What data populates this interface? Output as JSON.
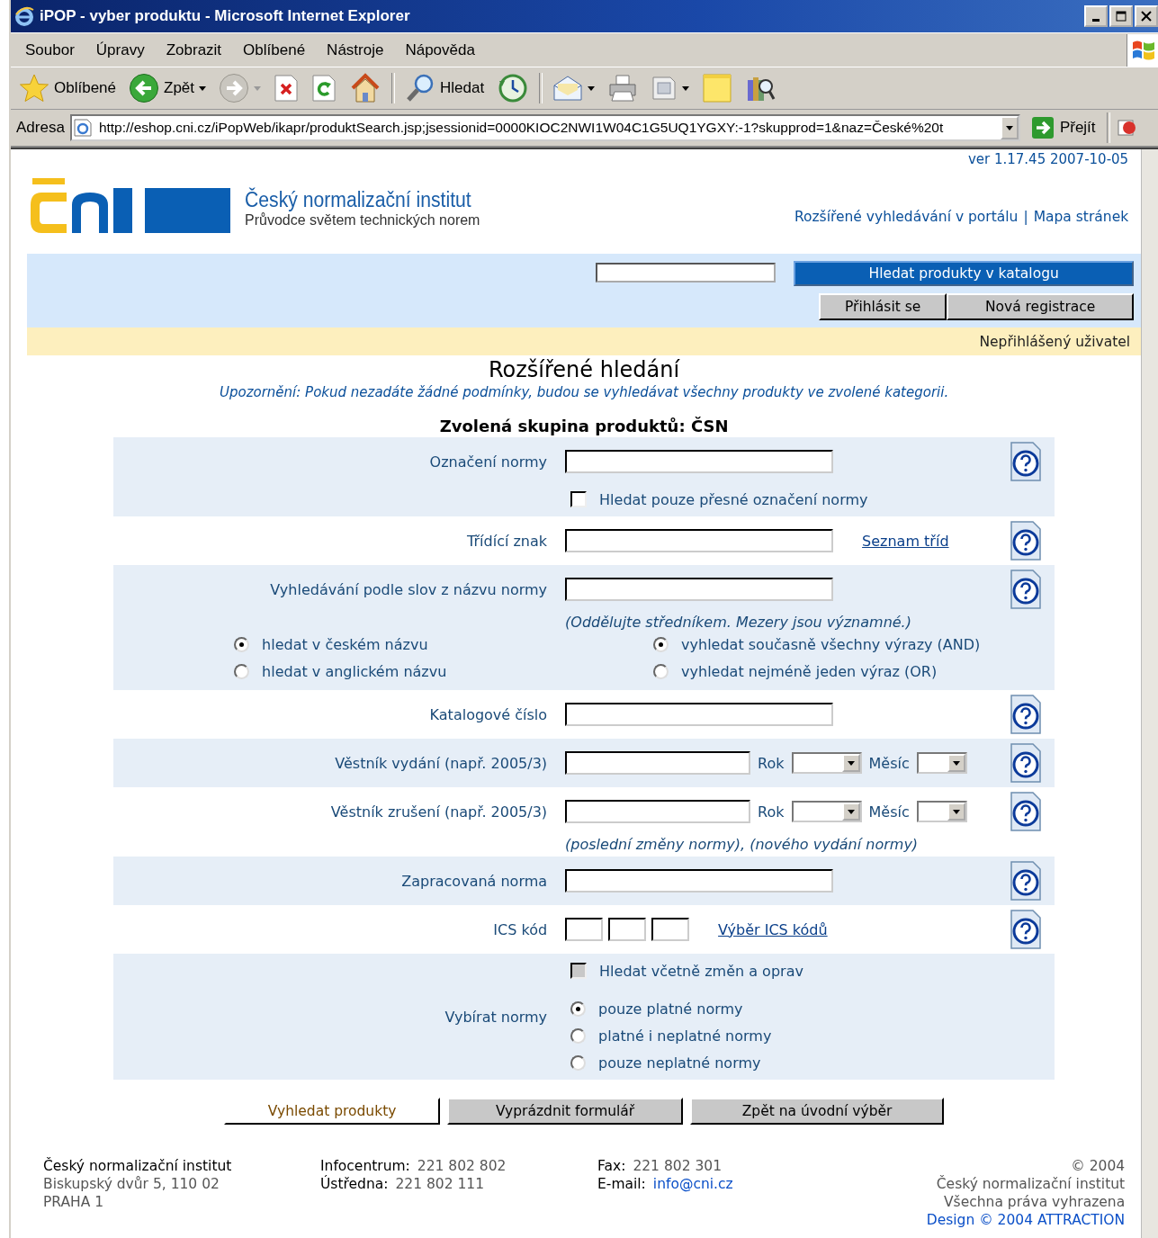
{
  "window": {
    "title": "iPOP - vyber produktu - Microsoft Internet Explorer"
  },
  "menu": [
    "Soubor",
    "Úpravy",
    "Zobrazit",
    "Oblíbené",
    "Nástroje",
    "Nápověda"
  ],
  "toolbar": [
    {
      "kind": "star",
      "label": "Oblíbené",
      "dropdown": false
    },
    {
      "kind": "back",
      "label": "Zpět",
      "dropdown": true
    },
    {
      "kind": "forward",
      "dropdown": true
    },
    {
      "kind": "stop",
      "dropdown": false
    },
    {
      "kind": "refresh",
      "dropdown": false
    },
    {
      "kind": "home",
      "dropdown": false
    },
    {
      "kind": "separator"
    },
    {
      "kind": "search",
      "label": "Hledat",
      "dropdown": false
    },
    {
      "kind": "history",
      "dropdown": false
    },
    {
      "kind": "separator"
    },
    {
      "kind": "mail",
      "dropdown": true
    },
    {
      "kind": "print",
      "dropdown": false
    },
    {
      "kind": "edit",
      "dropdown": true
    },
    {
      "kind": "note",
      "dropdown": false
    },
    {
      "kind": "research",
      "dropdown": false
    }
  ],
  "address": {
    "label": "Adresa",
    "url": "http://eshop.cni.cz/iPopWeb/ikapr/produktSearch.jsp;jsessionid=0000KIOC2NWI1W04C1G5UQ1YGXY:-1?skupprod=1&naz=České%20t",
    "go": "Přejít"
  },
  "page": {
    "version": "ver 1.17.45 2007-10-05",
    "logo": {
      "name": "Český normalizační institut",
      "tagline": "Průvodce světem technických norem"
    },
    "links": [
      "Rozšířené vyhledávání v portálu",
      "Mapa stránek"
    ],
    "link_separator": "|",
    "search_button": "Hledat produkty v katalogu",
    "account_buttons": [
      "Přihlásit se",
      "Nová registrace"
    ],
    "user_status": "Nepřihlášený uživatel",
    "heading": "Rozšířené hledání",
    "notice": "Upozornění: Pokud nezadáte žádné podmínky, budou se vyhledávat všechny produkty ve zvolené kategorii.",
    "group": "Zvolená skupina produktů: ČSN"
  },
  "form": [
    {
      "kind": "text",
      "label": "Označení normy",
      "help": true,
      "checkbox": {
        "label": "Hledat pouze přesné označení normy",
        "checked": false,
        "disabled": false
      }
    },
    {
      "kind": "text",
      "label": "Třídící znak",
      "help": true,
      "link": "Seznam tříd"
    },
    {
      "kind": "words",
      "label": "Vyhledávání podle slov z názvu normy",
      "help": true,
      "note": "(Oddělujte středníkem. Mezery jsou významné.)",
      "language_options": [
        {
          "label": "hledat v českém názvu",
          "selected": true
        },
        {
          "label": "hledat v anglickém názvu",
          "selected": false
        }
      ],
      "match_options": [
        {
          "label": "vyhledat současně všechny výrazy (AND)",
          "selected": true
        },
        {
          "label": "vyhledat nejméně jeden výraz (OR)",
          "selected": false
        }
      ]
    },
    {
      "kind": "text",
      "label": "Katalogové číslo",
      "help": true
    },
    {
      "kind": "date",
      "label": "Věstník vydání (např. 2005/3)",
      "help": true,
      "year_label": "Rok",
      "month_label": "Měsíc"
    },
    {
      "kind": "date",
      "label": "Věstník zrušení (např. 2005/3)",
      "help": true,
      "year_label": "Rok",
      "month_label": "Měsíc",
      "note": "(poslední změny normy), (nového vydání normy)"
    },
    {
      "kind": "text",
      "label": "Zapracovaná norma",
      "help": true
    },
    {
      "kind": "ics",
      "label": "ICS kód",
      "help": true,
      "link": "Výběr ICS kódů"
    },
    {
      "kind": "filter",
      "label": "Vybírat normy",
      "help": false,
      "checkbox": {
        "label": "Hledat včetně změn a oprav",
        "checked": false,
        "disabled": true
      },
      "options": [
        {
          "label": "pouze platné normy",
          "selected": true
        },
        {
          "label": "platné i neplatné normy",
          "selected": false
        },
        {
          "label": "pouze neplatné normy",
          "selected": false
        }
      ]
    }
  ],
  "buttons": [
    {
      "label": "Vyhledat produkty",
      "kind": "primary"
    },
    {
      "label": "Vyprázdnit formulář",
      "kind": "secondary"
    },
    {
      "label": "Zpět na úvodní výběr",
      "kind": "secondary"
    }
  ],
  "footer": {
    "name": "Český normalizační institut",
    "address_lines": [
      "Biskupský dvůr 5, 110 02",
      "PRAHA 1"
    ],
    "contact_columns": [
      [
        {
          "label": "Infocentrum:",
          "value": "221 802 802",
          "kind": "text"
        },
        {
          "label": "Ústředna:",
          "value": "221 802 111",
          "kind": "text"
        }
      ],
      [
        {
          "label": "Fax:",
          "value": "221 802 301",
          "kind": "text"
        },
        {
          "label": "E-mail:",
          "value": "info@cni.cz",
          "kind": "email"
        }
      ]
    ],
    "copyright": [
      "© 2004",
      "Český normalizační institut",
      "Všechna práva vyhrazena"
    ],
    "credit": "Design © 2004 ATTRACTION"
  }
}
